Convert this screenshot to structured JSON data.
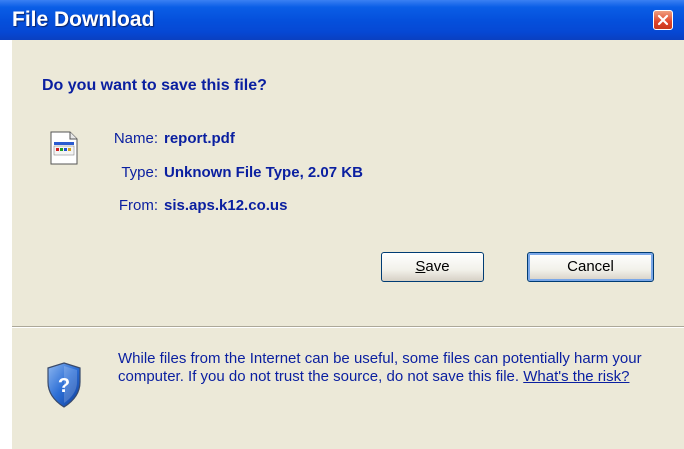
{
  "window": {
    "title": "File Download"
  },
  "question": "Do you want to save this file?",
  "file": {
    "name_label": "Name:",
    "name": "report.pdf",
    "type_label": "Type:",
    "type": "Unknown File Type, 2.07 KB",
    "from_label": "From:",
    "from": "sis.aps.k12.co.us"
  },
  "buttons": {
    "save_mnemonic": "S",
    "save_rest": "ave",
    "cancel": "Cancel"
  },
  "warning": {
    "text": "While files from the Internet can be useful, some files can potentially harm your computer. If you do not trust the source, do not save this file.",
    "link": "What's the risk?"
  },
  "colors": {
    "titlebar": "#0550dc",
    "dialog_bg": "#ece9d8",
    "text_blue": "#0a1fa0",
    "close": "#e0442a"
  },
  "icons": [
    "close-icon",
    "file-icon",
    "shield-icon"
  ]
}
